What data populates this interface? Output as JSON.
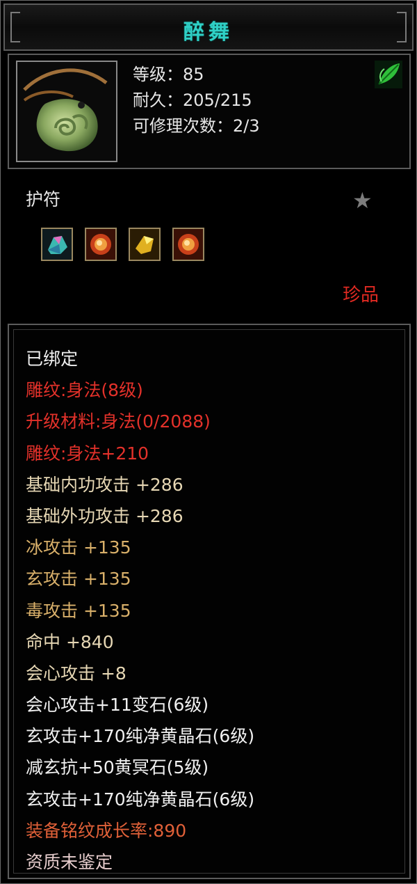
{
  "item": {
    "name": "醉舞",
    "level_line": "等级：85",
    "durability_line": "耐久：205/215",
    "repairs_line": "可修理次数：2/3",
    "type": "护符",
    "rarity": "珍品",
    "icon": "jade-pendant-icon",
    "leaf_icon": "green-leaf-icon",
    "star_icon": "star-icon",
    "gems": [
      "crystal-gem-icon",
      "fire-gem-icon",
      "gold-gem-icon",
      "fire-gem-icon"
    ]
  },
  "colors": {
    "title": "#2fd0c6",
    "red": "#e3312a",
    "beige": "#e6d7b4",
    "gold": "#d9b06a",
    "orange": "#e06038"
  },
  "attributes": [
    {
      "text": "已绑定",
      "color": "white"
    },
    {
      "text": "雕纹:身法(8级)",
      "color": "red"
    },
    {
      "text": "升级材料:身法(0/2088)",
      "color": "red"
    },
    {
      "text": "雕纹:身法+210",
      "color": "red"
    },
    {
      "text": "基础内功攻击  +286",
      "color": "beige"
    },
    {
      "text": "基础外功攻击  +286",
      "color": "beige"
    },
    {
      "text": "冰攻击  +135",
      "color": "gold"
    },
    {
      "text": "玄攻击  +135",
      "color": "gold"
    },
    {
      "text": "毒攻击  +135",
      "color": "gold"
    },
    {
      "text": "命中  +840",
      "color": "beige"
    },
    {
      "text": "会心攻击  +8",
      "color": "beige"
    },
    {
      "text": "会心攻击+11变石(6级)",
      "color": "white"
    },
    {
      "text": "玄攻击+170纯净黄晶石(6级)",
      "color": "white"
    },
    {
      "text": "减玄抗+50黄冥石(5级)",
      "color": "white"
    },
    {
      "text": "玄攻击+170纯净黄晶石(6级)",
      "color": "white"
    },
    {
      "text": "装备铭纹成长率:890",
      "color": "orange"
    },
    {
      "text": "资质未鉴定",
      "color": "pink"
    }
  ]
}
